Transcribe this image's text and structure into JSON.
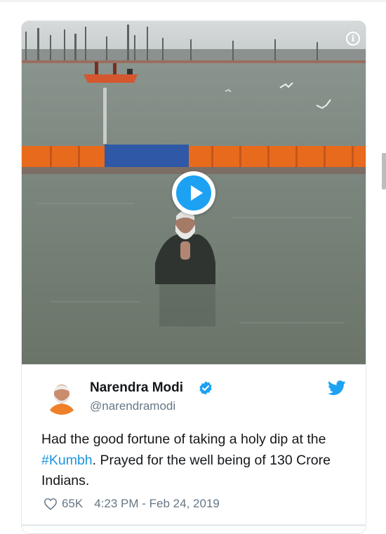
{
  "media": {
    "info_icon": "info-icon",
    "play_icon": "play-icon",
    "accent": "#1da1f2"
  },
  "tweet": {
    "author_name": "Narendra Modi",
    "author_handle": "@narendramodi",
    "verified_icon": "verified-badge-icon",
    "brand_icon": "twitter-bird-icon",
    "text_before": "Had the good fortune of taking a holy dip at the ",
    "hashtag": "#Kumbh",
    "text_after": ". Prayed for the well being of 130 Crore Indians.",
    "likes": "65K",
    "timestamp": "4:23 PM - Feb 24, 2019",
    "heart_icon": "heart-icon",
    "link_color": "#1b95e0",
    "verified_color": "#1da1f2"
  }
}
